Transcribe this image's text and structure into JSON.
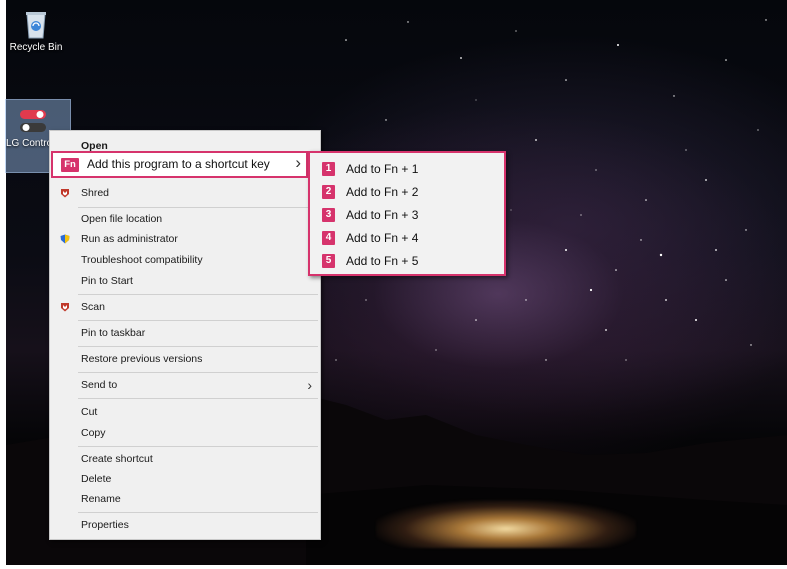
{
  "desktop": {
    "icons": [
      {
        "label": "Recycle Bin",
        "icon": "recycle-bin-icon"
      },
      {
        "label": "LG Control Center",
        "icon": "toggle-switches-icon"
      }
    ]
  },
  "context_menu": {
    "open": "Open",
    "shortcut_key": "Add this program to a shortcut key",
    "shortcut_badge": "Fn",
    "shred": "Shred",
    "open_file_location": "Open file location",
    "run_as_admin": "Run as administrator",
    "troubleshoot": "Troubleshoot compatibility",
    "pin_to_start": "Pin to Start",
    "scan": "Scan",
    "pin_to_taskbar": "Pin to taskbar",
    "restore_versions": "Restore previous versions",
    "send_to": "Send to",
    "cut": "Cut",
    "copy": "Copy",
    "create_shortcut": "Create shortcut",
    "delete": "Delete",
    "rename": "Rename",
    "properties": "Properties"
  },
  "submenu": {
    "items": [
      {
        "num": "1",
        "label": "Add to Fn + 1"
      },
      {
        "num": "2",
        "label": "Add to Fn + 2"
      },
      {
        "num": "3",
        "label": "Add to Fn + 3"
      },
      {
        "num": "4",
        "label": "Add to Fn + 4"
      },
      {
        "num": "5",
        "label": "Add to Fn + 5"
      }
    ]
  },
  "colors": {
    "accent": "#d6336c",
    "menu_bg": "#f0f0f0",
    "shield_blue": "#2b6cd4",
    "shield_yellow": "#f4c20d",
    "mcafee_red": "#c0392b"
  }
}
